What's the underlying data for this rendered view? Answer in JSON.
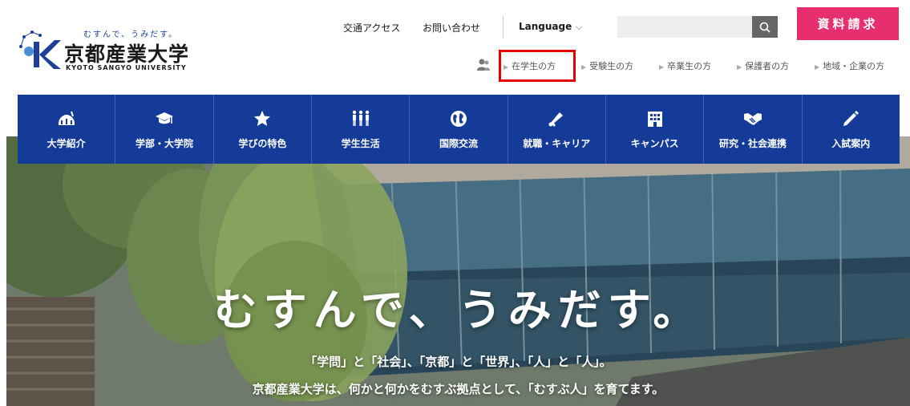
{
  "logo": {
    "tagline": "むすんで、うみだす。",
    "name": "京都産業大学",
    "name_en": "KYOTO SANGYO UNIVERSITY"
  },
  "utility": {
    "access": "交通アクセス",
    "contact": "お問い合わせ",
    "language": "Language",
    "search_placeholder": "",
    "request": "資料請求"
  },
  "audience": {
    "items": [
      {
        "label": "在学生の方"
      },
      {
        "label": "受験生の方"
      },
      {
        "label": "卒業生の方"
      },
      {
        "label": "保護者の方"
      },
      {
        "label": "地域・企業の方"
      }
    ]
  },
  "nav": {
    "items": [
      {
        "label": "大学紹介",
        "icon": "building-dome-icon"
      },
      {
        "label": "学部・大学院",
        "icon": "graduation-cap-icon"
      },
      {
        "label": "学びの特色",
        "icon": "star-icon"
      },
      {
        "label": "学生生活",
        "icon": "people-icon"
      },
      {
        "label": "国際交流",
        "icon": "globe-icon"
      },
      {
        "label": "就職・キャリア",
        "icon": "megaphone-icon"
      },
      {
        "label": "キャンパス",
        "icon": "campus-building-icon"
      },
      {
        "label": "研究・社会連携",
        "icon": "handshake-icon"
      },
      {
        "label": "入試案内",
        "icon": "pencil-icon"
      }
    ]
  },
  "hero": {
    "catch": "むすんで、うみだす。",
    "line1": "「学問」と「社会」、「京都」と「世界」、「人」と「人」。",
    "line2": "京都産業大学は、何かと何かをむすぶ拠点として、「むすぶ人」を育てます。"
  },
  "colors": {
    "nav_bg": "#133b97",
    "request_bg": "#e72e6e",
    "highlight": "#e30000"
  }
}
